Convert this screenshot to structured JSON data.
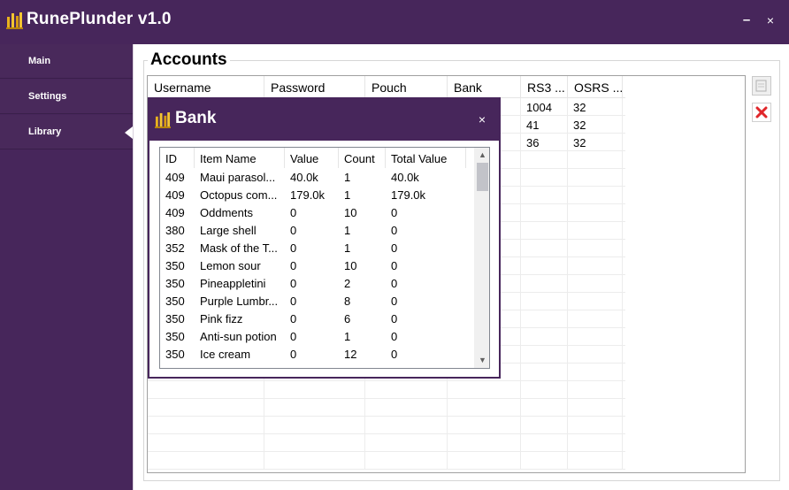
{
  "app": {
    "title": "RunePlunder v1.0",
    "logo_icon": "gold-bars-icon"
  },
  "window_controls": {
    "minimize": "–",
    "close": "×"
  },
  "sidebar": {
    "items": [
      {
        "label": "Main"
      },
      {
        "label": "Settings"
      },
      {
        "label": "Library",
        "active": true
      }
    ]
  },
  "accounts": {
    "title": "Accounts",
    "columns": [
      "Username",
      "Password",
      "Pouch",
      "Bank",
      "RS3 ...",
      "OSRS ..."
    ],
    "rows": [
      [
        "",
        "",
        "",
        "",
        "1004",
        "32"
      ],
      [
        "",
        "",
        "",
        "",
        "41",
        "32"
      ],
      [
        "",
        "",
        "",
        "",
        "36",
        "32"
      ]
    ],
    "tools": {
      "export_icon": "export-icon",
      "delete_icon": "delete-x-icon"
    }
  },
  "bank_dialog": {
    "title": "Bank",
    "close": "×",
    "columns": [
      "ID",
      "Item Name",
      "Value",
      "Count",
      "Total Value"
    ],
    "rows": [
      [
        "409",
        "Maui parasol...",
        "40.0k",
        "1",
        "40.0k"
      ],
      [
        "409",
        "Octopus com...",
        "179.0k",
        "1",
        "179.0k"
      ],
      [
        "409",
        "Oddments",
        "0",
        "10",
        "0"
      ],
      [
        "380",
        "Large shell",
        "0",
        "1",
        "0"
      ],
      [
        "352",
        "Mask of the T...",
        "0",
        "1",
        "0"
      ],
      [
        "350",
        "Lemon sour",
        "0",
        "10",
        "0"
      ],
      [
        "350",
        "Pineappletini",
        "0",
        "2",
        "0"
      ],
      [
        "350",
        "Purple Lumbr...",
        "0",
        "8",
        "0"
      ],
      [
        "350",
        "Pink fizz",
        "0",
        "6",
        "0"
      ],
      [
        "350",
        "Anti-sun potion",
        "0",
        "1",
        "0"
      ],
      [
        "350",
        "Ice cream",
        "0",
        "12",
        "0"
      ]
    ],
    "scroll": {
      "up": "▲",
      "down": "▼"
    }
  },
  "colors": {
    "accent": "#47265b",
    "delete": "#e0262a"
  }
}
